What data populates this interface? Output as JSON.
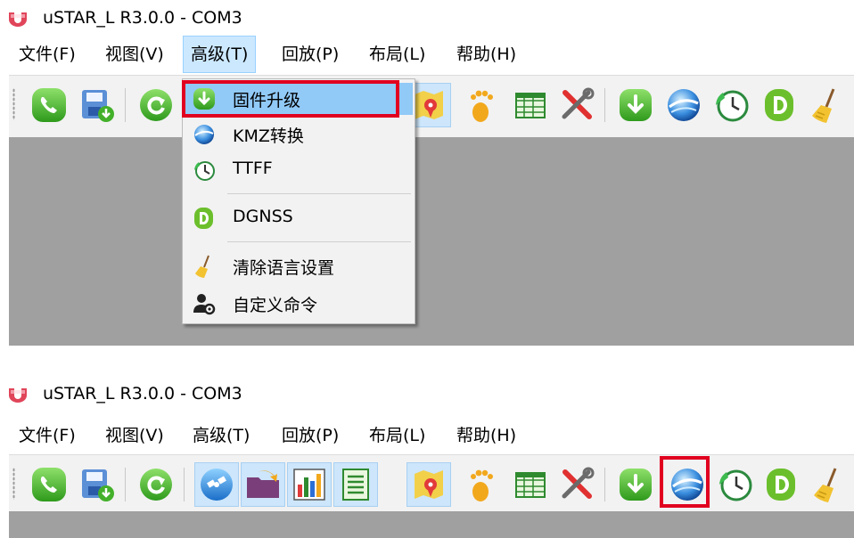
{
  "window": {
    "title": "uSTAR_L R3.0.0 - COM3"
  },
  "menubar": {
    "items": [
      {
        "label": "文件(F)"
      },
      {
        "label": "视图(V)"
      },
      {
        "label": "高级(T)"
      },
      {
        "label": "回放(P)"
      },
      {
        "label": "布局(L)"
      },
      {
        "label": "帮助(H)"
      }
    ],
    "active": "高级(T)"
  },
  "dropdown": {
    "items": [
      {
        "label": "固件升级",
        "icon": "firmware-upgrade-icon",
        "highlighted": true
      },
      {
        "label": "KMZ转换",
        "icon": "globe-icon"
      },
      {
        "label": "TTFF",
        "icon": "clock-icon"
      },
      {
        "label": "DGNSS",
        "icon": "dgnss-icon"
      },
      {
        "label": "清除语言设置",
        "icon": "broom-icon"
      },
      {
        "label": "自定义命令",
        "icon": "user-gear-icon"
      }
    ]
  },
  "toolbar": {
    "top_buttons": [
      "connect-icon",
      "save-icon",
      "refresh-icon",
      "map-pin-icon",
      "footprint-icon",
      "spreadsheet-icon",
      "tools-icon",
      "download-icon",
      "globe-icon",
      "clock-icon",
      "dgnss-icon",
      "broom-icon"
    ],
    "bottom_buttons": [
      "connect-icon",
      "save-icon",
      "refresh-icon",
      "satellite-icon",
      "folder-icon",
      "bar-chart-icon",
      "list-icon",
      "map-pin-icon",
      "footprint-icon",
      "spreadsheet-icon",
      "tools-icon",
      "download-icon",
      "globe-icon",
      "clock-icon",
      "dgnss-icon",
      "broom-icon"
    ]
  },
  "colors": {
    "highlight_box": "#e1001f",
    "menu_hover": "#91c9f7",
    "workarea": "#a0a0a0"
  }
}
